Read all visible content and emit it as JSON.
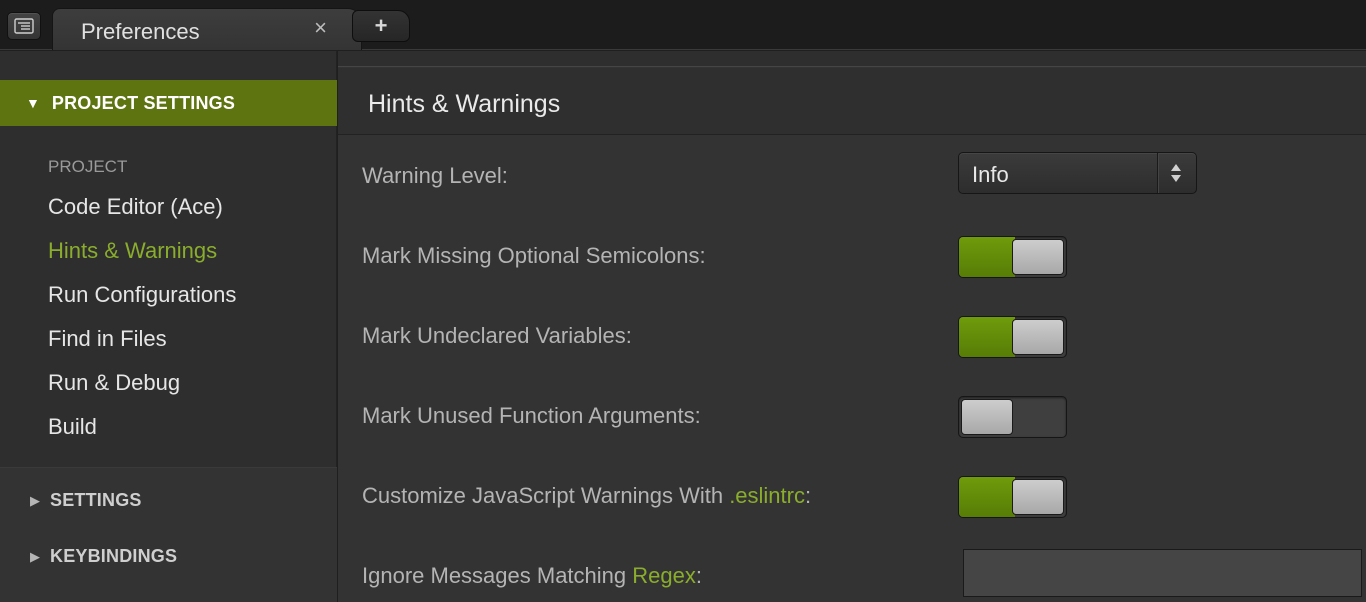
{
  "tabbar": {
    "tab_title": "Preferences",
    "close_glyph": "×",
    "new_tab_glyph": "+"
  },
  "sidebar": {
    "project_settings_label": "PROJECT SETTINGS",
    "expanded_arrow": "▼",
    "collapsed_arrow": "▶",
    "group_label": "PROJECT",
    "items": [
      {
        "label": "Code Editor (Ace)",
        "active": false
      },
      {
        "label": "Hints & Warnings",
        "active": true
      },
      {
        "label": "Run Configurations",
        "active": false
      },
      {
        "label": "Find in Files",
        "active": false
      },
      {
        "label": "Run & Debug",
        "active": false
      },
      {
        "label": "Build",
        "active": false
      }
    ],
    "settings_label": "SETTINGS",
    "keybindings_label": "KEYBINDINGS"
  },
  "main": {
    "title": "Hints & Warnings",
    "warning_level": {
      "label": "Warning Level:",
      "value": "Info"
    },
    "semicolons": {
      "label": "Mark Missing Optional Semicolons:",
      "enabled": true
    },
    "undeclared": {
      "label": "Mark Undeclared Variables:",
      "enabled": true
    },
    "unused_args": {
      "label": "Mark Unused Function Arguments:",
      "enabled": false
    },
    "eslint": {
      "label_prefix": "Customize JavaScript Warnings With ",
      "label_link": ".eslintrc",
      "label_suffix": ":",
      "enabled": true
    },
    "ignore_regex": {
      "label_prefix": "Ignore Messages Matching ",
      "label_link": "Regex",
      "label_suffix": ":",
      "value": ""
    }
  },
  "colors": {
    "accent_green": "#5e7410",
    "active_text": "#8aad2c",
    "toggle_on": "#6f9b0c"
  }
}
